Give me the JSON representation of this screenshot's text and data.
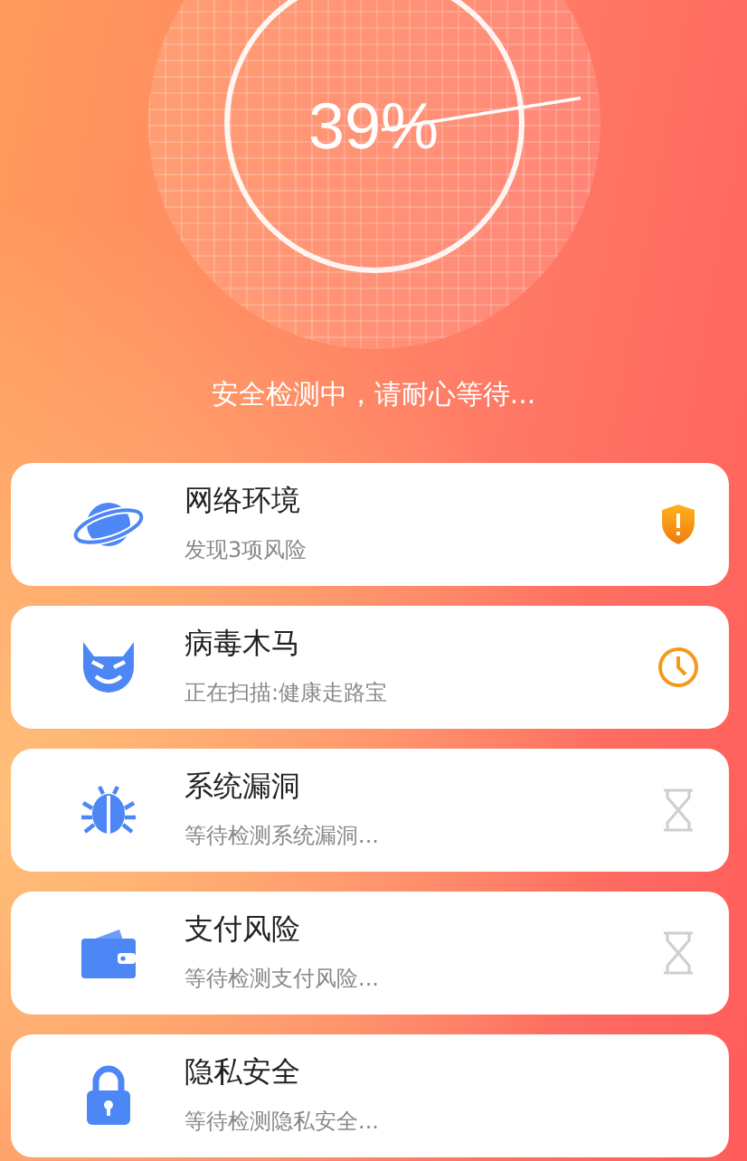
{
  "scan": {
    "percent": "39%",
    "status_text": "安全检测中，请耐心等待..."
  },
  "items": [
    {
      "title": "网络环境",
      "subtitle": "发现3项风险",
      "status": {
        "kind": "warning"
      }
    },
    {
      "title": "病毒木马",
      "subtitle": "正在扫描:健康走路宝",
      "status": {
        "kind": "scanning"
      }
    },
    {
      "title": "系统漏洞",
      "subtitle": "等待检测系统漏洞...",
      "status": {
        "kind": "waiting"
      }
    },
    {
      "title": "支付风险",
      "subtitle": "等待检测支付风险...",
      "status": {
        "kind": "waiting"
      }
    },
    {
      "title": "隐私安全",
      "subtitle": "等待检测隐私安全..."
    }
  ]
}
